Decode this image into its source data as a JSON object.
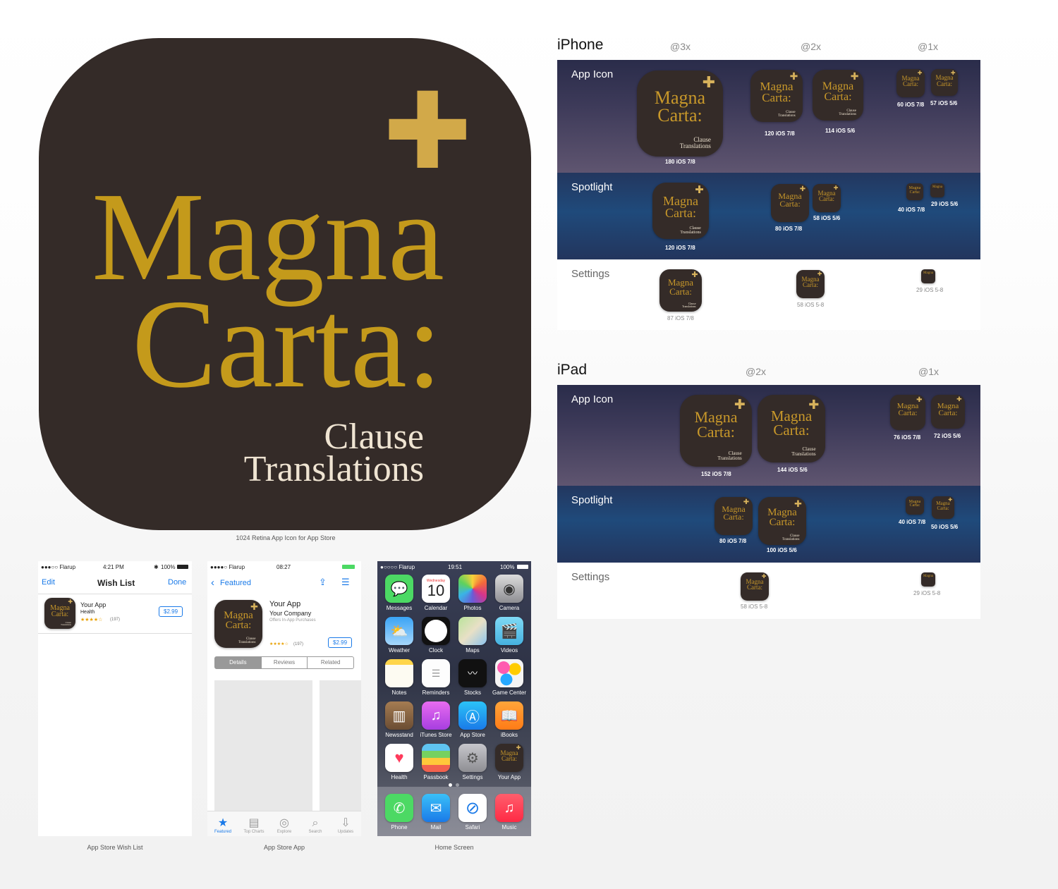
{
  "icon": {
    "title_line1": "Magna",
    "title_line2": "Carta:",
    "sub_line1": "Clause",
    "sub_line2": "Translations",
    "cross": "✚"
  },
  "hero_caption": "1024 Retina App Icon for App Store",
  "iphone": {
    "title": "iPhone",
    "cols": [
      "@3x",
      "@2x",
      "@1x"
    ],
    "rows": {
      "app_icon": "App Icon",
      "spotlight": "Spotlight",
      "settings": "Settings"
    },
    "sizes": {
      "a180": "180 iOS 7/8",
      "a120": "120 iOS 7/8",
      "a114": "114 iOS 5/6",
      "a60": "60 iOS 7/8",
      "a57": "57 iOS 5/6",
      "s120": "120 iOS 7/8",
      "s80": "80 iOS 7/8",
      "s58": "58 iOS 5/6",
      "s40": "40 iOS 7/8",
      "s29": "29 iOS 5/6",
      "t87": "87 iOS 7/8",
      "t58": "58 iOS 5-8",
      "t29": "29 iOS 5-8"
    }
  },
  "ipad": {
    "title": "iPad",
    "cols": [
      "@2x",
      "@1x"
    ],
    "rows": {
      "app_icon": "App Icon",
      "spotlight": "Spotlight",
      "settings": "Settings"
    },
    "sizes": {
      "a152": "152 iOS 7/8",
      "a144": "144 iOS 5/6",
      "a76": "76 iOS 7/8",
      "a72": "72 iOS 5/6",
      "s80": "80 iOS 7/8",
      "s100": "100 iOS 5/6",
      "s40": "40 iOS 7/8",
      "s50": "50 iOS 5/6",
      "t58": "58 iOS 5-8",
      "t29": "29 iOS 5-8"
    }
  },
  "wishlist": {
    "status_carrier": "●●●○○ Flarup",
    "status_time": "4:21 PM",
    "status_battery": "100%",
    "nav_left": "Edit",
    "nav_title": "Wish List",
    "nav_right": "Done",
    "app_name": "Your App",
    "app_category": "Health",
    "rating": "★★★★☆",
    "rating_count": "(197)",
    "price": "$2.99",
    "caption": "App Store Wish List"
  },
  "appstore": {
    "status_carrier": "●●●●○ Flarup",
    "status_time": "08:27",
    "nav_back": "Featured",
    "app_name": "Your App",
    "company": "Your Company",
    "offers": "Offers In-App Purchases",
    "rating": "★★★★☆",
    "rating_count": "(197)",
    "price": "$2.99",
    "seg": [
      "Details",
      "Reviews",
      "Related"
    ],
    "tabs": [
      "Featured",
      "Top Charts",
      "Explore",
      "Search",
      "Updates"
    ],
    "caption": "App Store App"
  },
  "homescreen": {
    "status_carrier": "●○○○○ Flarup",
    "status_time": "19:51",
    "status_battery": "100%",
    "calendar_day": "Wednesday",
    "calendar_date": "10",
    "apps": [
      "Messages",
      "Calendar",
      "Photos",
      "Camera",
      "Weather",
      "Clock",
      "Maps",
      "Videos",
      "Notes",
      "Reminders",
      "Stocks",
      "Game Center",
      "Newsstand",
      "iTunes Store",
      "App Store",
      "iBooks",
      "Health",
      "Passbook",
      "Settings",
      "Your App"
    ],
    "dock": [
      "Phone",
      "Mail",
      "Safari",
      "Music"
    ],
    "caption": "Home Screen"
  }
}
